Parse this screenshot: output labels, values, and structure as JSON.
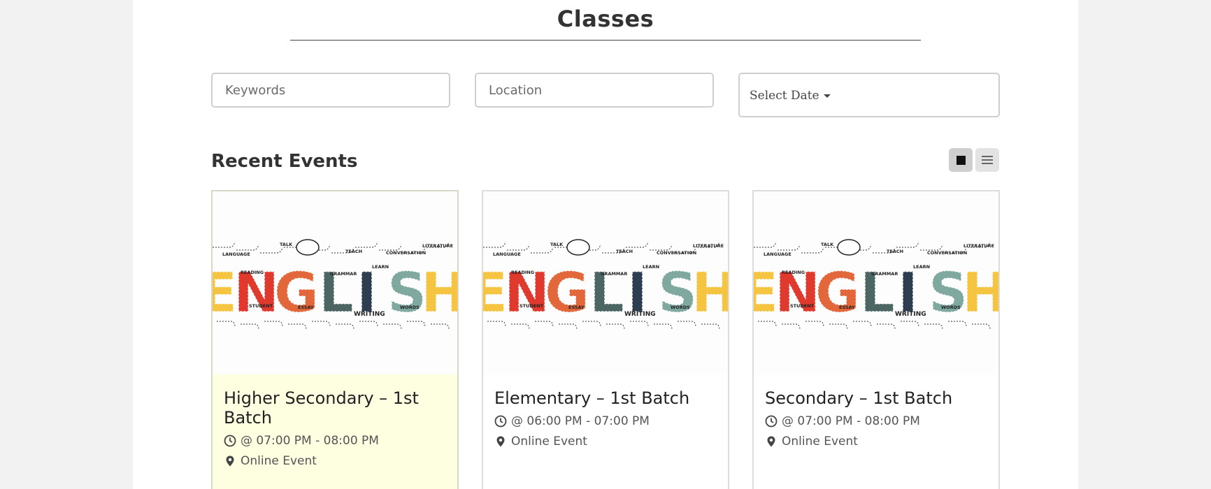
{
  "page": {
    "title": "Classes"
  },
  "filters": {
    "keywords_placeholder": "Keywords",
    "location_placeholder": "Location",
    "date_label": "Select Date"
  },
  "section": {
    "title": "Recent Events"
  },
  "view_toggle": {
    "active": "grid",
    "grid_icon": "grid-view-icon",
    "list_icon": "list-view-icon"
  },
  "image": {
    "word": "ENGLISH",
    "labels": [
      "TALK",
      "TEACH",
      "LITERATURE",
      "LANGUAGE",
      "CONVERSATION",
      "STUDENT",
      "ESSAY",
      "WRITING",
      "WORDS",
      "GRAMMAR",
      "LEARN",
      "READING"
    ],
    "letter_colors": [
      "#f5c542",
      "#e03a2f",
      "#e2683c",
      "#4b6663",
      "#2c3e50",
      "#7fa89f",
      "#f5c542"
    ]
  },
  "events": [
    {
      "title": "Higher Secondary – 1st Batch",
      "time": "@ 07:00 PM - 08:00 PM",
      "location": "Online Event"
    },
    {
      "title": "Elementary – 1st Batch",
      "time": "@ 06:00 PM - 07:00 PM",
      "location": "Online Event"
    },
    {
      "title": "Secondary – 1st Batch",
      "time": "@ 07:00 PM - 08:00 PM",
      "location": "Online Event"
    }
  ]
}
